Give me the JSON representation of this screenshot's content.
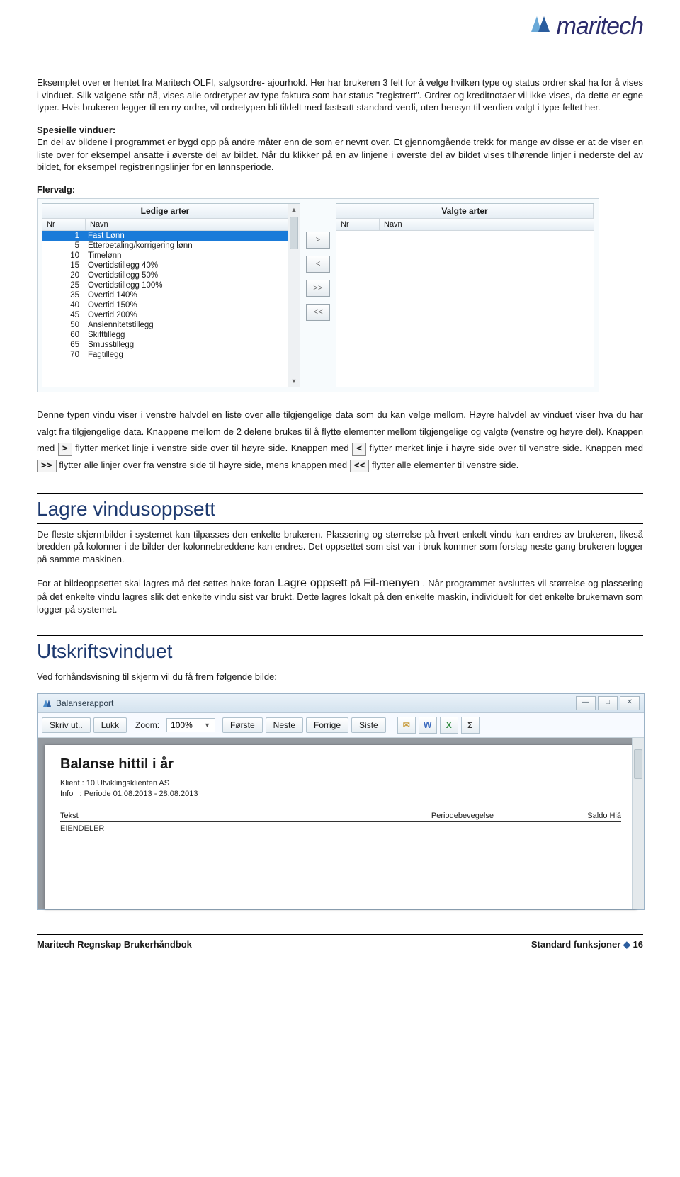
{
  "header": {
    "logo_text": "maritech"
  },
  "body": {
    "para1": "Eksemplet over er hentet fra Maritech OLFI, salgsordre- ajourhold. Her har brukeren 3 felt for å velge hvilken type og status ordrer skal ha for å vises i vinduet. Slik valgene står nå, vises alle ordretyper av type faktura som har status \"registrert\". Ordrer og kreditnotaer vil ikke vises, da dette er egne typer. Hvis brukeren legger til en ny ordre, vil ordretypen bli tildelt med fastsatt standard-verdi, uten hensyn til verdien valgt i type-feltet her.",
    "spesielle_heading": "Spesielle vinduer:",
    "para2": "En del av bildene i programmet er bygd opp på andre måter enn de som er nevnt over. Et gjennomgående trekk for mange av disse er at de viser en liste over for eksempel ansatte i øverste del av bildet. Når du klikker på en av linjene i øverste del av bildet vises tilhørende linjer i nederste del av bildet, for eksempel registreringslinjer for en lønnsperiode.",
    "flervalg_heading": "Flervalg:",
    "picker": {
      "left_title": "Ledige arter",
      "right_title": "Valgte arter",
      "col_nr": "Nr",
      "col_navn": "Navn",
      "rows": [
        {
          "nr": "1",
          "navn": "Fast Lønn",
          "selected": true
        },
        {
          "nr": "5",
          "navn": "Etterbetaling/korrigering lønn"
        },
        {
          "nr": "10",
          "navn": "Timelønn"
        },
        {
          "nr": "15",
          "navn": "Overtidstillegg 40%"
        },
        {
          "nr": "20",
          "navn": "Overtidstillegg 50%"
        },
        {
          "nr": "25",
          "navn": "Overtidstillegg 100%"
        },
        {
          "nr": "35",
          "navn": "Overtid 140%"
        },
        {
          "nr": "40",
          "navn": "Overtid 150%"
        },
        {
          "nr": "45",
          "navn": "Overtid 200%"
        },
        {
          "nr": "50",
          "navn": "Ansiennitetstillegg"
        },
        {
          "nr": "60",
          "navn": "Skifttillegg"
        },
        {
          "nr": "65",
          "navn": "Smusstillegg"
        },
        {
          "nr": "70",
          "navn": "Fagtillegg"
        }
      ],
      "buttons": {
        "right": ">",
        "left": "<",
        "all_right": ">>",
        "all_left": "<<"
      }
    },
    "para3a": "Denne typen vindu viser i venstre halvdel en liste over alle tilgjengelige data som du kan velge mellom. Høyre halvdel av vinduet viser hva du har valgt fra tilgjengelige data. Knappene mellom de 2 delene brukes til å flytte elementer mellom tilgjengelige og valgte (venstre og høyre del). Knappen med ",
    "para3b": " flytter merket linje i venstre side over til høyre side. Knappen med ",
    "para3c": " flytter merket linje i høyre side over til venstre side. Knappen med ",
    "para3d": " flytter alle linjer over fra venstre side til høyre side, mens knappen med ",
    "para3e": " flytter alle elementer til venstre side.",
    "inline_btn": {
      "gt": ">",
      "lt": "<",
      "gtgt": ">>",
      "ltlt": "<<"
    },
    "h_lagre": "Lagre vindusoppsett",
    "para4": "De fleste skjermbilder i systemet kan tilpasses den enkelte brukeren. Plassering og størrelse på hvert enkelt vindu kan endres av brukeren, likeså bredden på kolonner i de bilder der kolonnebreddene kan endres. Det oppsettet som sist var i bruk kommer som forslag neste gang brukeren logger på samme maskinen.",
    "para5a": "For at bildeoppsettet skal lagres må det settes hake foran ",
    "para5b": "Lagre oppsett",
    "para5c": " på ",
    "para5d": "Fil-menyen",
    "para5e": ". Når programmet avsluttes vil størrelse og plassering på det enkelte vindu lagres slik det enkelte vindu sist var brukt. Dette lagres lokalt på den enkelte maskin, individuelt for det enkelte brukernavn som logger på systemet.",
    "h_utskrift": "Utskriftsvinduet",
    "para6": "Ved forhåndsvisning til skjerm vil du få frem følgende bilde:"
  },
  "report_window": {
    "title": "Balanserapport",
    "toolbar": {
      "skriv_ut": "Skriv ut..",
      "lukk": "Lukk",
      "zoom_label": "Zoom:",
      "zoom_value": "100%",
      "forste": "Første",
      "neste": "Neste",
      "forrige": "Forrige",
      "siste": "Siste",
      "icons": {
        "mail": "✉",
        "word": "W",
        "excel": "X",
        "sum": "Σ"
      }
    },
    "report": {
      "title": "Balanse hittil i år",
      "klient_label": "Klient",
      "klient_value": "10 Utviklingsklienten AS",
      "info_label": "Info",
      "info_value": "Periode 01.08.2013 - 28.08.2013",
      "col_tekst": "Tekst",
      "col_periode": "Periodebevegelse",
      "col_saldo": "Saldo Hiå",
      "first_row": "EIENDELER"
    }
  },
  "footer": {
    "left": "Maritech Regnskap Brukerhåndbok",
    "right_a": "Standard funksjoner",
    "right_b": "16",
    "bullet": "◆"
  }
}
